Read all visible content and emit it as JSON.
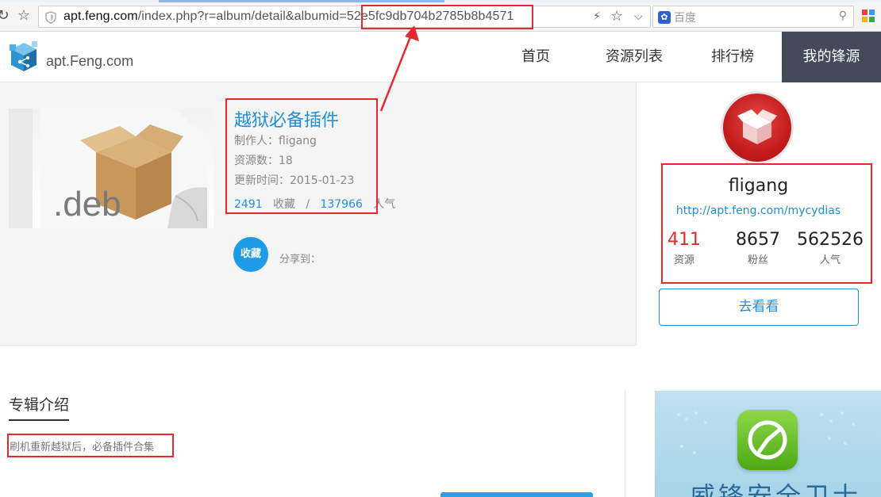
{
  "browser": {
    "url_host": "apt.feng.com",
    "url_path": "/index.php?r=album/detail&albumid=",
    "url_id": "52e5fc9db704b2785b8b4571",
    "search_placeholder": "百度"
  },
  "site": {
    "logo_text": "apt.Feng.com",
    "nav": [
      {
        "label": "首页"
      },
      {
        "label": "资源列表"
      },
      {
        "label": "排行榜"
      },
      {
        "label": "我的锋源",
        "active": true
      }
    ]
  },
  "album": {
    "title": "越狱必备插件",
    "author_label": "制作人：fligang",
    "count_label": "资源数：18",
    "updated_label": "更新时间：2015-01-23",
    "favorites": "2491",
    "favorites_label": "收藏",
    "separator": "/",
    "popularity": "137966",
    "popularity_label": "人气",
    "fav_button": "收藏",
    "share_label": "分享到："
  },
  "user": {
    "name": "fligang",
    "link": "http://apt.feng.com/mycydias",
    "stats": [
      {
        "value": "411",
        "label": "资源"
      },
      {
        "value": "8657",
        "label": "粉丝"
      },
      {
        "value": "562526",
        "label": "人气"
      }
    ],
    "visit_button": "去看看"
  },
  "intro": {
    "title": "专辑介绍",
    "text": "刷机重新越狱后，必备插件合集"
  },
  "ad": {
    "text": "威锋安全卫士"
  },
  "colors": {
    "accent": "#1e8fd8",
    "nav_active_bg": "#434a5a",
    "highlight_red": "#e8282b",
    "stat_red": "#e3262b"
  }
}
